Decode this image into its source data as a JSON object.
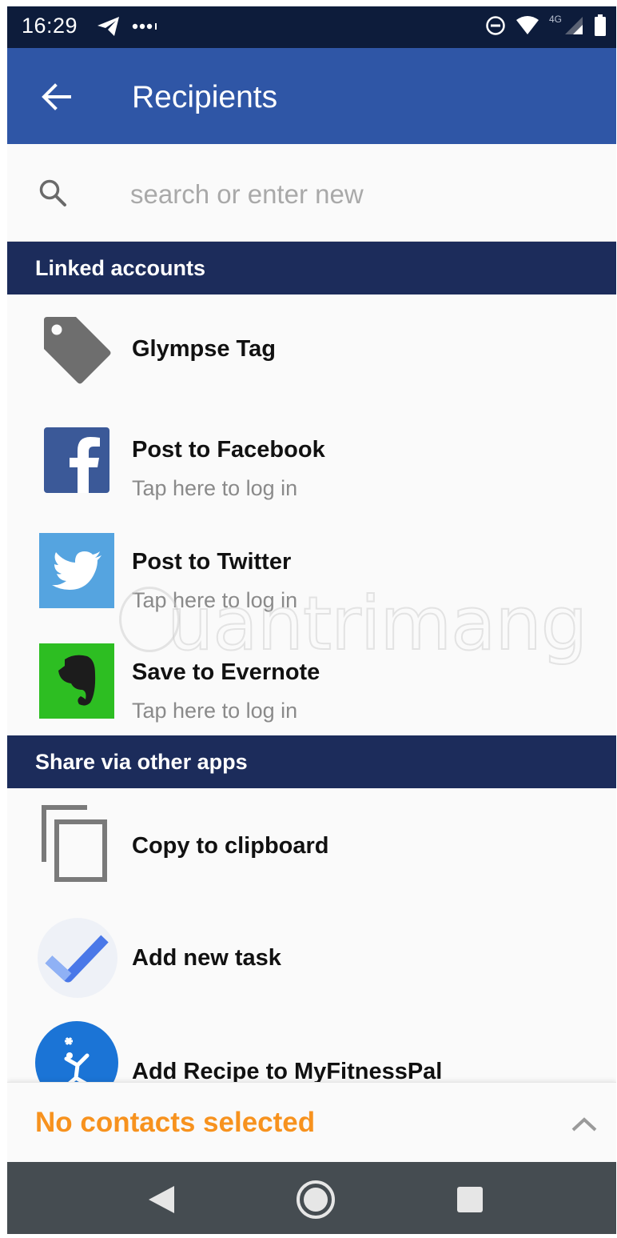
{
  "status_bar": {
    "time": "16:29",
    "network_label": "4G"
  },
  "app_bar": {
    "title": "Recipients"
  },
  "search": {
    "placeholder": "search or enter new"
  },
  "sections": {
    "linked_accounts": {
      "title": "Linked accounts",
      "items": [
        {
          "title": "Glympse Tag",
          "subtitle": "",
          "icon": "tag-icon"
        },
        {
          "title": "Post to Facebook",
          "subtitle": "Tap here to log in",
          "icon": "facebook-icon"
        },
        {
          "title": "Post to Twitter",
          "subtitle": "Tap here to log in",
          "icon": "twitter-icon"
        },
        {
          "title": "Save to Evernote",
          "subtitle": "Tap here to log in",
          "icon": "evernote-icon"
        }
      ]
    },
    "other_apps": {
      "title": "Share via other apps",
      "items": [
        {
          "title": "Copy to clipboard",
          "icon": "clipboard-icon"
        },
        {
          "title": "Add new task",
          "icon": "tasks-icon"
        },
        {
          "title": "Add Recipe to MyFitnessPal",
          "icon": "myfitnesspal-icon"
        }
      ]
    }
  },
  "selection_bar": {
    "text": "No contacts selected"
  },
  "watermark": {
    "text": "uantrimang"
  },
  "colors": {
    "app_bar": "#2f56a6",
    "section_header": "#1c2c5b",
    "status_bar": "#0d1c3b",
    "selection_text": "#f7921e",
    "nav_bar": "#454c51"
  }
}
